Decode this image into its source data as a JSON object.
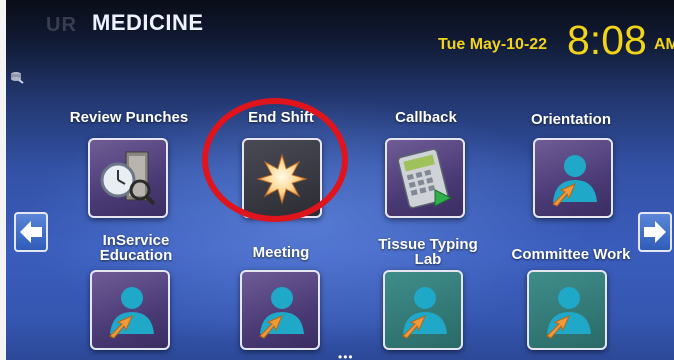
{
  "header": {
    "logo_faint": "UR",
    "logo": "MEDICINE",
    "date": "Tue May-10-22",
    "time": "8:08",
    "ampm": "AM"
  },
  "tiles": [
    {
      "label": "Review Punches",
      "icon": "time-clock-search-icon",
      "bg": "purple"
    },
    {
      "label": "End Shift",
      "icon": "star-burst-icon",
      "bg": "dark"
    },
    {
      "label": "Callback",
      "icon": "calculator-icon",
      "bg": "purple"
    },
    {
      "label": "Orientation",
      "icon": "user-arrow-icon",
      "bg": "purple"
    },
    {
      "label": "InService Education",
      "icon": "user-arrow-icon",
      "bg": "purple"
    },
    {
      "label": "Meeting",
      "icon": "user-arrow-icon",
      "bg": "purple"
    },
    {
      "label": "Tissue Typing Lab",
      "icon": "user-arrow-icon",
      "bg": "teal"
    },
    {
      "label": "Committee Work",
      "icon": "user-arrow-icon",
      "bg": "teal"
    }
  ],
  "nav": {
    "prev_icon": "arrow-left-icon",
    "next_icon": "arrow-right-icon",
    "page_indicator": "•••"
  },
  "colors": {
    "clock": "#f2d417",
    "highlight": "#e0141c",
    "tile_purple": "#4a3a75",
    "tile_teal": "#2a6a68"
  }
}
